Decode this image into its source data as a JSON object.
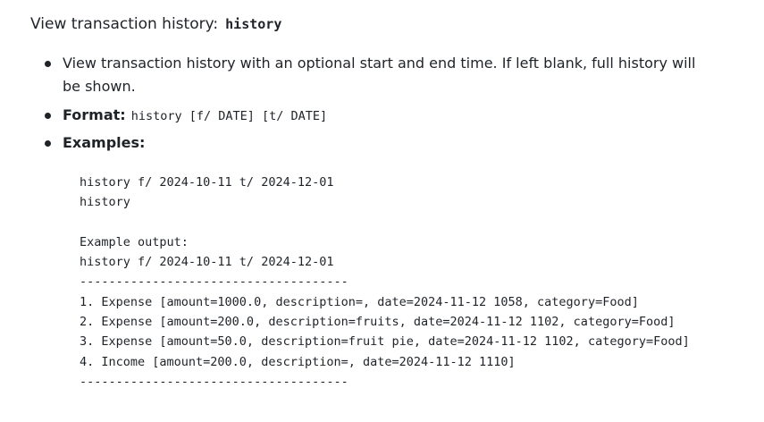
{
  "heading": {
    "label": "View transaction history:",
    "command": "history"
  },
  "bullets": [
    {
      "text": "View transaction history with an optional start and end time. If left blank, full history will be shown."
    },
    {
      "label": "Format:",
      "code": "history [f/ DATE] [t/ DATE]"
    },
    {
      "label": "Examples:"
    }
  ],
  "code_block": {
    "lines": [
      "history f/ 2024-10-11 t/ 2024-12-01",
      "history",
      "",
      "Example output:",
      "history f/ 2024-10-11 t/ 2024-12-01",
      "-------------------------------------",
      "1. Expense [amount=1000.0, description=, date=2024-11-12 1058, category=Food]",
      "2. Expense [amount=200.0, description=fruits, date=2024-11-12 1102, category=Food]",
      "3. Expense [amount=50.0, description=fruit pie, date=2024-11-12 1102, category=Food]",
      "4. Income [amount=200.0, description=, date=2024-11-12 1110]",
      "-------------------------------------"
    ]
  }
}
